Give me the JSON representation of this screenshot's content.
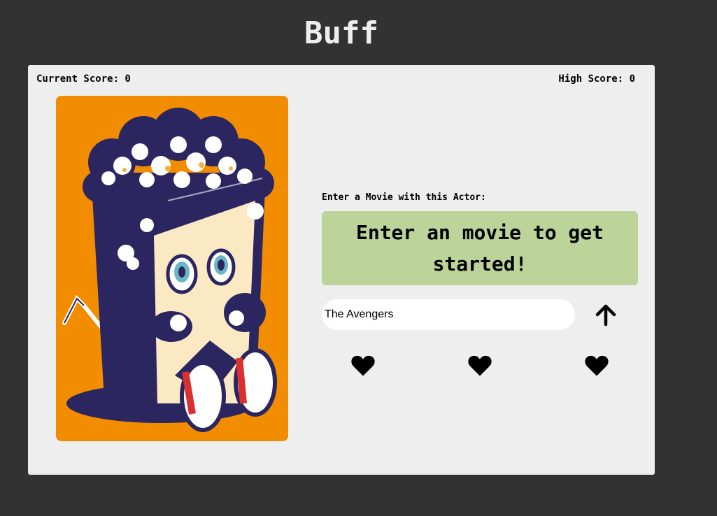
{
  "header": {
    "title": "Buff"
  },
  "scoreboard": {
    "current_score_text": "Current Score: 0",
    "high_score_text": "High Score: 0"
  },
  "poster": {
    "icon": "popcorn-mascot-illustration",
    "background_color": "#f28c00"
  },
  "game": {
    "prompt_label": "Enter a Movie with this Actor:",
    "message": "Enter an movie to get started!",
    "message_color": "#bcd39a",
    "input_value": "The Avengers",
    "submit_icon": "arrow-up-icon"
  },
  "lives": {
    "icon": "heart-icon",
    "count": 3
  },
  "colors": {
    "page_background": "#323232",
    "card_background": "#eeeeee",
    "poster_dark": "#2b2560",
    "poster_cream": "#fbe9c3"
  }
}
